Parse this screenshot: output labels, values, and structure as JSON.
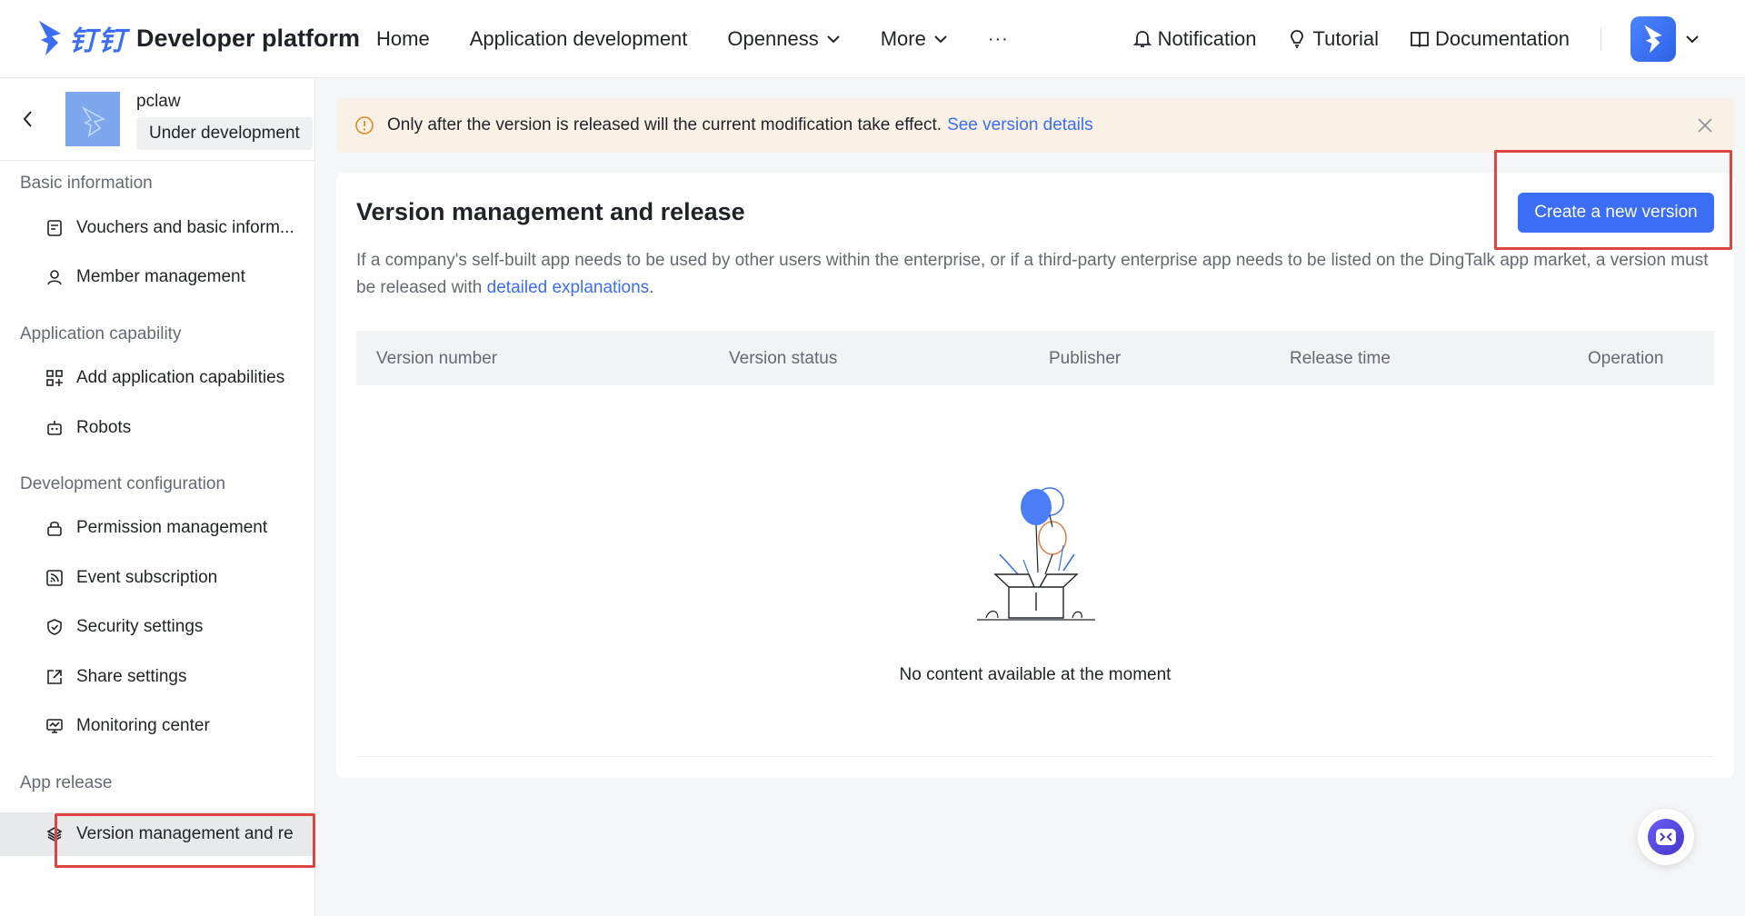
{
  "header": {
    "brand_cn": "钉钉",
    "brand_name": "Developer platform",
    "nav": [
      {
        "label": "Home"
      },
      {
        "label": "Application development"
      },
      {
        "label": "Openness"
      },
      {
        "label": "More"
      }
    ],
    "more_dots": "···",
    "right": {
      "notification": "Notification",
      "tutorial": "Tutorial",
      "documentation": "Documentation"
    }
  },
  "sidebar": {
    "app_name": "pclaw",
    "app_status": "Under development",
    "groups": {
      "basic": "Basic information",
      "capability": "Application capability",
      "dev": "Development configuration",
      "release": "App release"
    },
    "items": [
      {
        "label": "Vouchers and basic inform..."
      },
      {
        "label": "Member management"
      },
      {
        "label": "Add application capabilities"
      },
      {
        "label": "Robots"
      },
      {
        "label": "Permission management"
      },
      {
        "label": "Event subscription"
      },
      {
        "label": "Security settings"
      },
      {
        "label": "Share settings"
      },
      {
        "label": "Monitoring center"
      },
      {
        "label": "Version management and re"
      }
    ]
  },
  "banner": {
    "text": "Only after the version is released will the current modification take effect.",
    "link": "See version details"
  },
  "main": {
    "title": "Version management and release",
    "create_button": "Create a new version",
    "desc_text": "If a company's self-built app needs to be used by other users within the enterprise, or if a third-party enterprise app needs to be listed on the DingTalk app market, a version must be released with",
    "desc_link": "detailed explanations",
    "desc_end": ".",
    "columns": [
      "Version number",
      "Version status",
      "Publisher",
      "Release time",
      "Operation"
    ],
    "empty_text": "No content available at the moment"
  },
  "colors": {
    "accent": "#3b6ef5",
    "highlight_box": "#e0443e",
    "banner_bg": "#faf1e6"
  }
}
